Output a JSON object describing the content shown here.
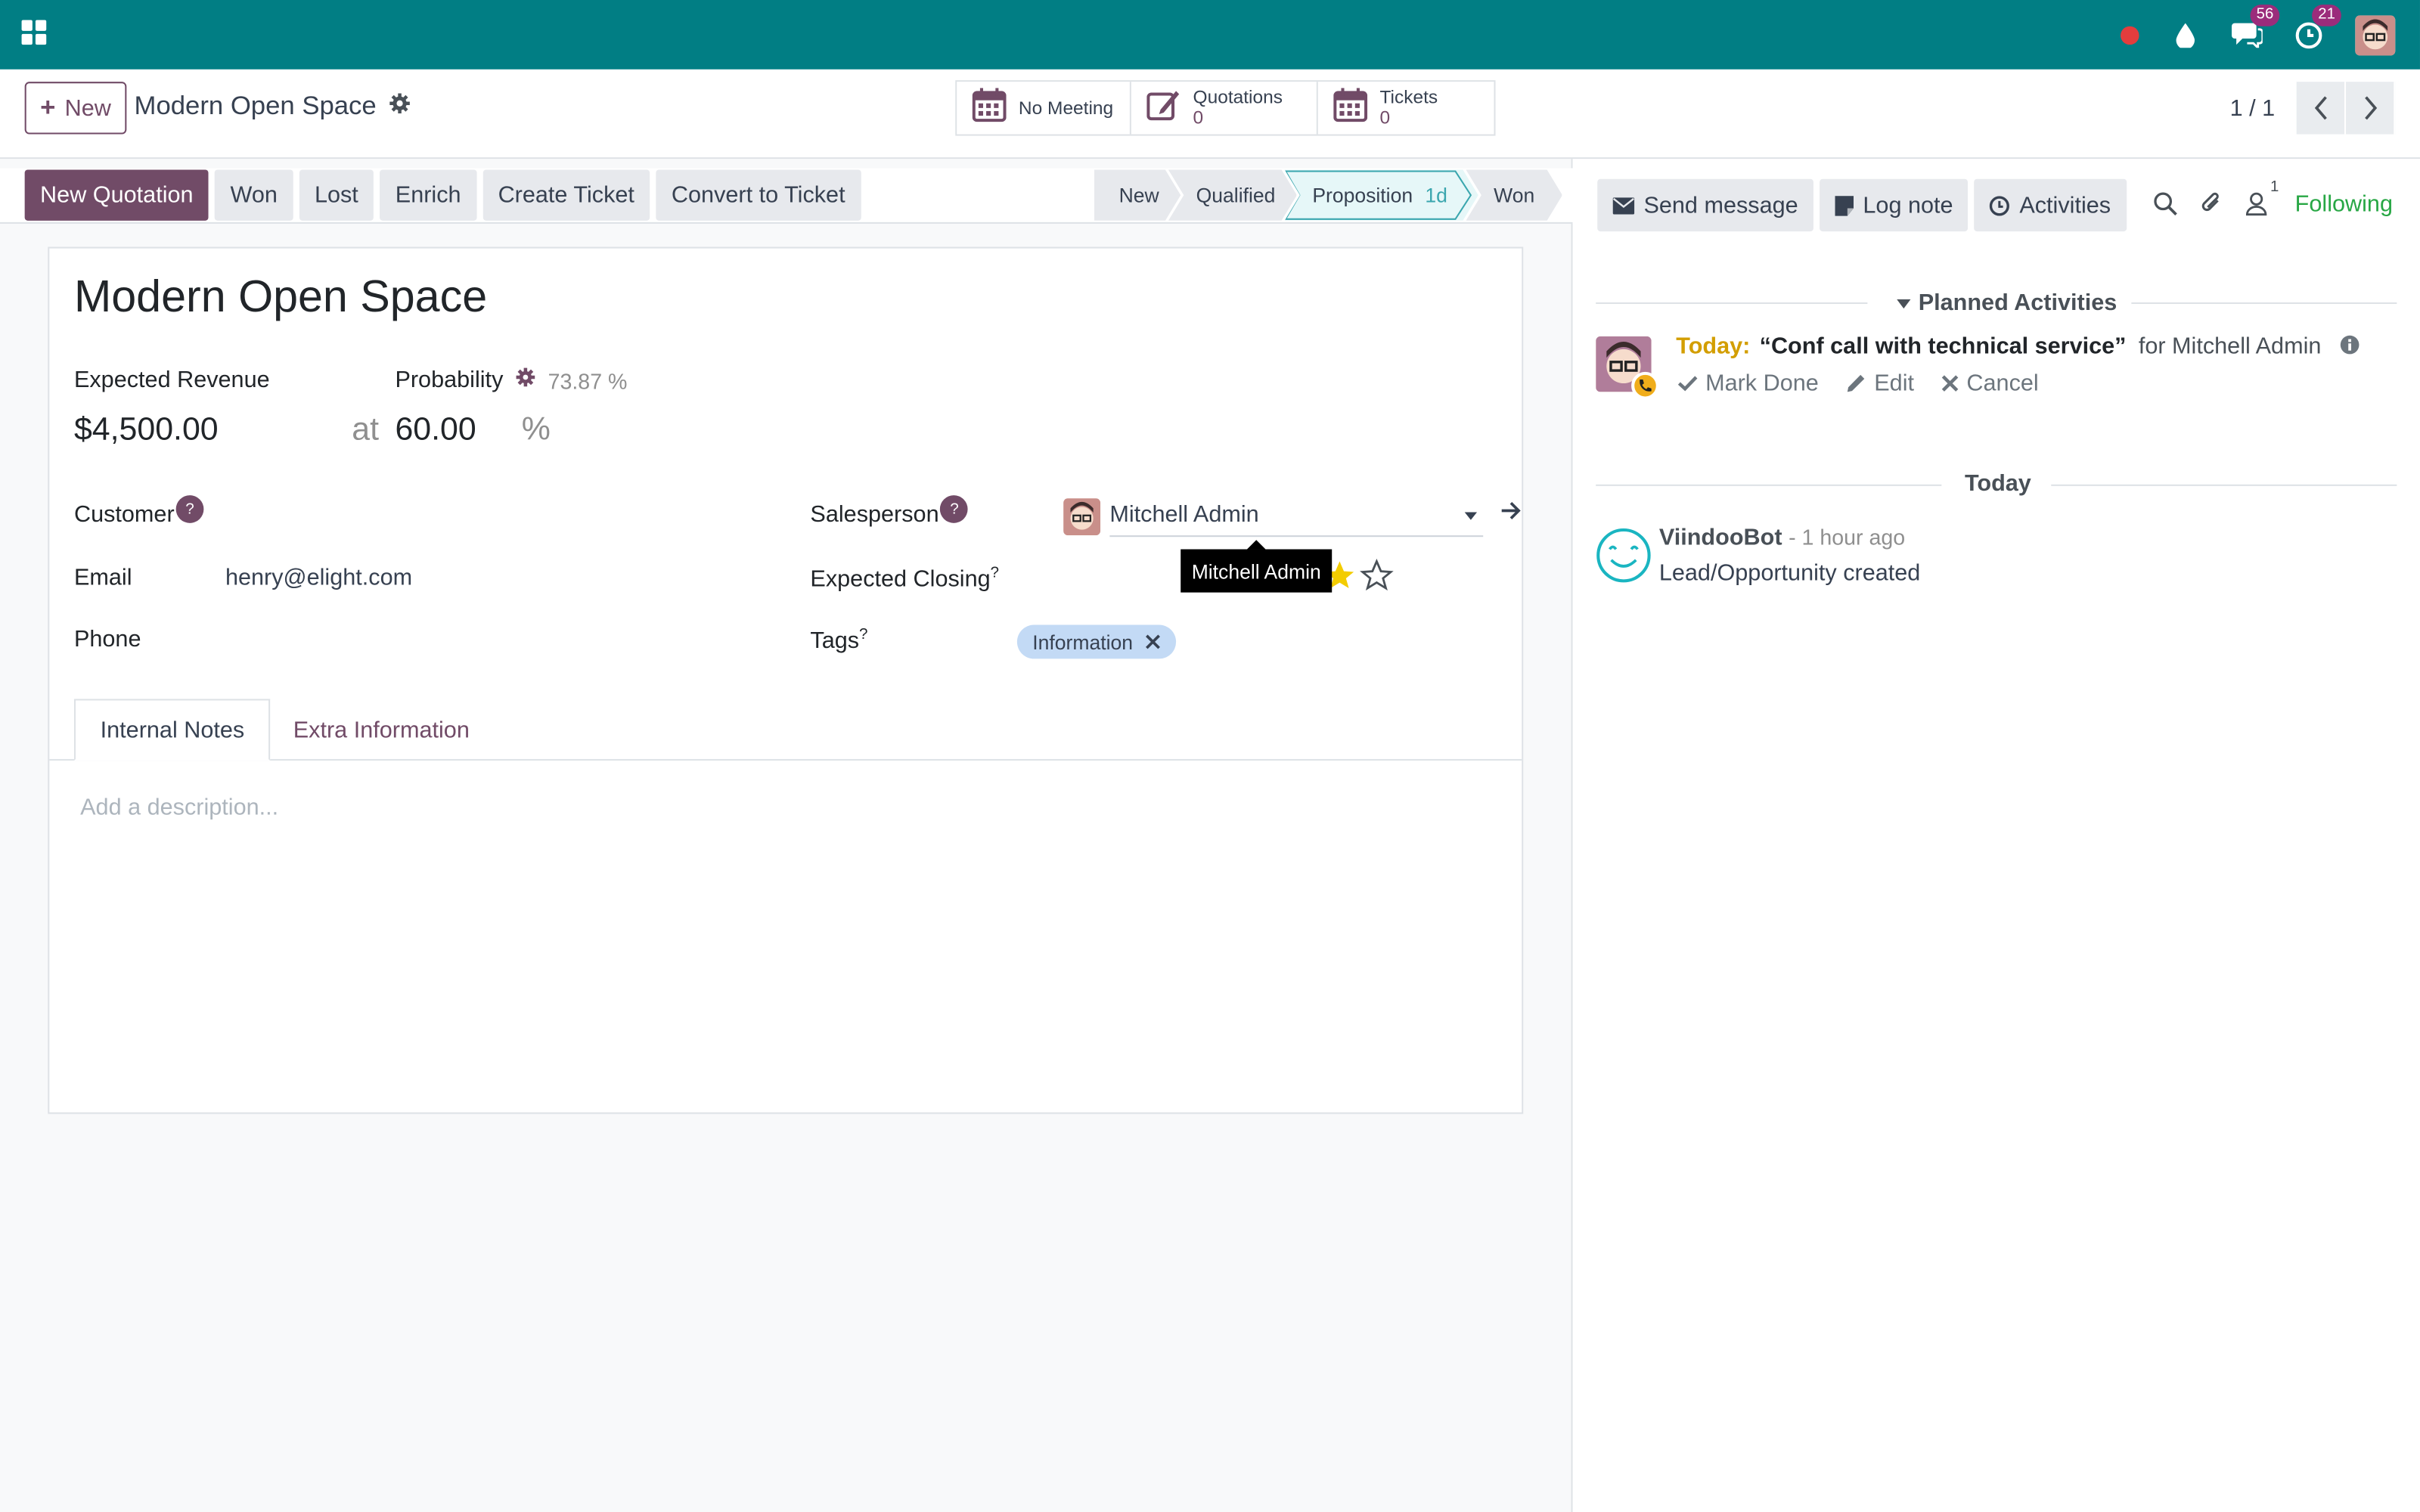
{
  "colors": {
    "navbar": "#017e84",
    "primary": "#714b67",
    "accent_green": "#28a745",
    "today_yellow": "#d39e00",
    "tag_bg": "#c3daf5"
  },
  "navbar": {
    "apps_icon": "grid-icon",
    "chat_count": "56",
    "activity_count": "21"
  },
  "control_panel": {
    "new_label": "New",
    "record_name": "Modern Open Space",
    "smart_buttons": [
      {
        "icon": "calendar-icon",
        "label": "No Meeting",
        "value": ""
      },
      {
        "icon": "edit-icon",
        "label": "Quotations",
        "value": "0"
      },
      {
        "icon": "calendar-icon",
        "label": "Tickets",
        "value": "0"
      }
    ],
    "pager": "1 / 1"
  },
  "header": {
    "buttons": [
      "New Quotation",
      "Won",
      "Lost",
      "Enrich",
      "Create Ticket",
      "Convert to Ticket"
    ],
    "stages": [
      {
        "label": "New",
        "duration": ""
      },
      {
        "label": "Qualified",
        "duration": ""
      },
      {
        "label": "Proposition",
        "duration": "1d"
      },
      {
        "label": "Won",
        "duration": ""
      }
    ]
  },
  "form": {
    "title": "Modern Open Space",
    "expected_revenue_label": "Expected Revenue",
    "expected_revenue": "$4,500.00",
    "at_label": "at",
    "probability_label": "Probability",
    "probability_auto": "73.87 %",
    "probability": "60.00",
    "percent_sign": "%",
    "customer_label": "Customer",
    "help_mark": "?",
    "email_label": "Email",
    "email": "henry@elight.com",
    "phone_label": "Phone",
    "salesperson_label": "Salesperson",
    "salesperson": "Mitchell Admin",
    "tooltip": "Mitchell Admin",
    "expected_closing_label": "Expected Closing",
    "tags_label": "Tags",
    "tags": [
      "Information"
    ],
    "priority_stars": 2,
    "tabs": [
      "Internal Notes",
      "Extra Information"
    ],
    "description_placeholder": "Add a description..."
  },
  "chatter": {
    "send_message": "Send message",
    "log_note": "Log note",
    "activities": "Activities",
    "follower_count": "1",
    "following": "Following",
    "planned_activities_title": "Planned Activities",
    "activity": {
      "when": "Today:",
      "summary": "“Conf call with technical service”",
      "for": "for Mitchell Admin",
      "mark_done": "Mark Done",
      "edit": "Edit",
      "cancel": "Cancel"
    },
    "date_separator": "Today",
    "message": {
      "author": "ViindooBot",
      "date": "- 1 hour ago",
      "body": "Lead/Opportunity created"
    }
  }
}
